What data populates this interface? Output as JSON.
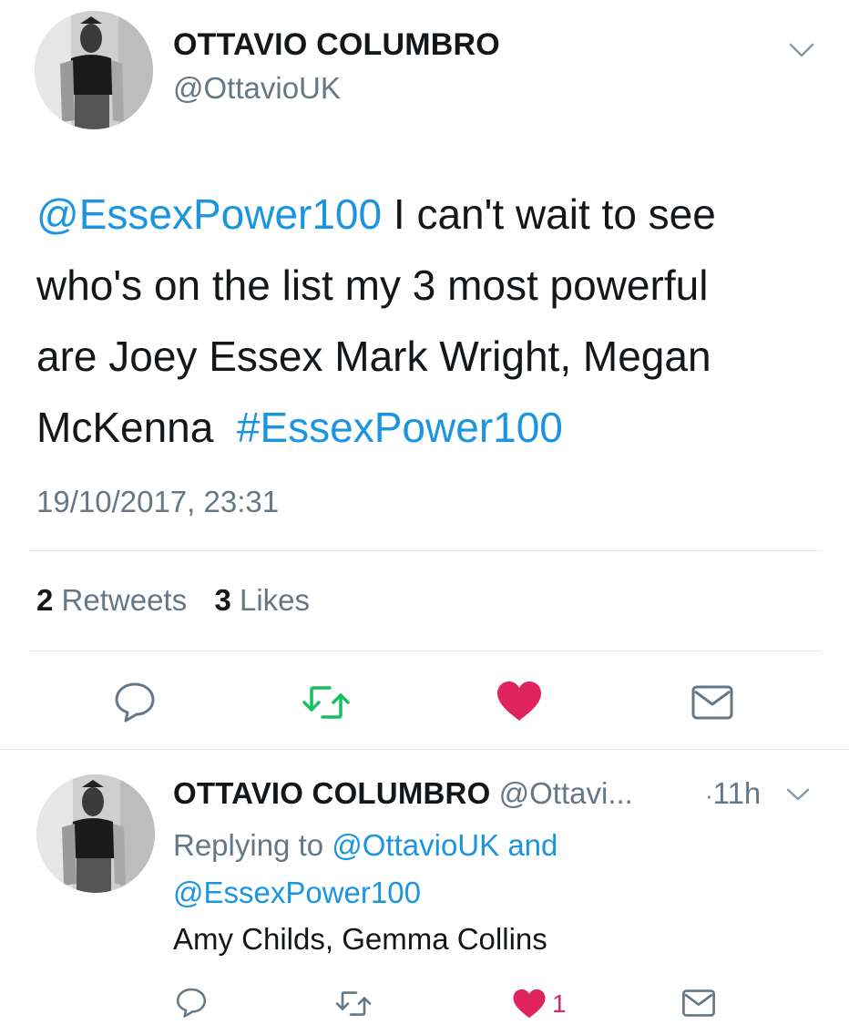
{
  "main_tweet": {
    "display_name": "OTTAVIO COLUMBRO",
    "handle": "@OttavioUK",
    "text": {
      "mention": "@EssexPower100",
      "line1_rest": " I can't wait to see",
      "line2": "who's on the list my 3 most powerful",
      "line3": "are Joey Essex Mark Wright, Megan",
      "line4_start": "McKenna ",
      "hashtag": "#EssexPower100"
    },
    "timestamp": "19/10/2017, 23:31",
    "retweet_count": "2",
    "retweet_label": "Retweets",
    "like_count": "3",
    "like_label": "Likes"
  },
  "reply_tweet": {
    "display_name": "OTTAVIO COLUMBRO",
    "handle": "@Ottavi...",
    "time": "11h",
    "replying_prefix": "Replying to ",
    "replying_user1": "@OttavioUK",
    "replying_and": " and",
    "replying_user2": "@EssexPower100",
    "text": "Amy Childs, Gemma Collins",
    "like_count": "1"
  },
  "colors": {
    "link": "#1b95e0",
    "retweet_active": "#17bf63",
    "like_active": "#e0245e",
    "muted": "#657786",
    "divider": "#e1e8ed"
  },
  "icons": {
    "chevron": "chevron-down-icon",
    "reply": "reply-icon",
    "retweet": "retweet-icon",
    "like": "heart-icon",
    "message": "envelope-icon"
  }
}
